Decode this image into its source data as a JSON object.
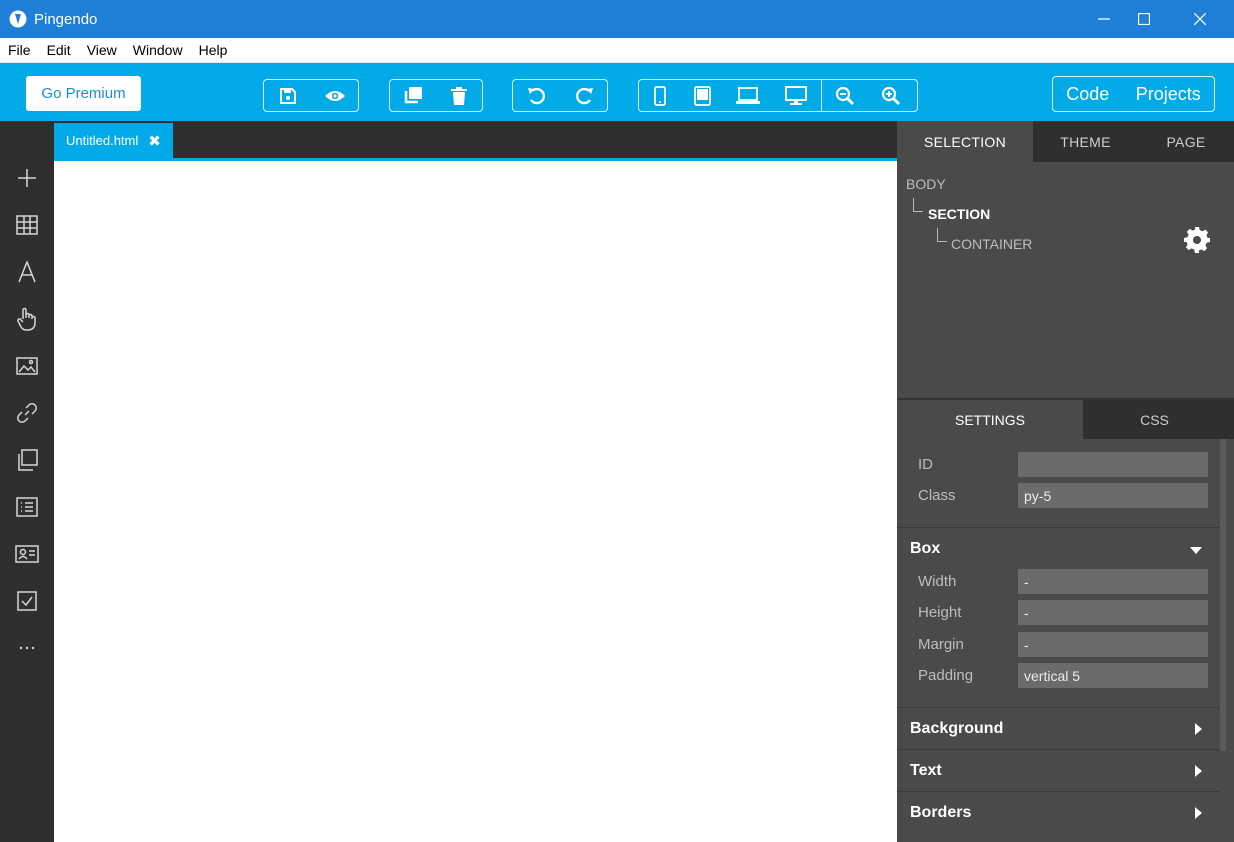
{
  "window": {
    "title": "Pingendo",
    "controls": [
      "minimize-icon",
      "maximize-icon",
      "close-icon"
    ]
  },
  "menu": [
    "File",
    "Edit",
    "View",
    "Window",
    "Help"
  ],
  "toolbar": {
    "premium_label": "Go Premium",
    "code_label": "Code",
    "projects_label": "Projects",
    "icons": [
      "save-icon",
      "preview-icon",
      "duplicate-icon",
      "delete-icon",
      "undo-icon",
      "redo-icon",
      "phone-icon",
      "tablet-icon",
      "laptop-icon",
      "desktop-icon",
      "zoom-out-icon",
      "zoom-in-icon"
    ]
  },
  "sidebar": {
    "icons": [
      "add-icon",
      "grid-icon",
      "text-icon",
      "hand-pointer-icon",
      "image-icon",
      "link-icon",
      "copy-icon",
      "list-icon",
      "card-icon",
      "checkbox-icon",
      "more-icon"
    ]
  },
  "editor": {
    "tab_label": "Untitled.html",
    "tab_close": "✖"
  },
  "panel": {
    "tabs": [
      "SELECTION",
      "THEME",
      "PAGE"
    ],
    "tree": {
      "body": "BODY",
      "section": "SECTION",
      "container": "CONTAINER"
    },
    "settings_tabs": [
      "SETTINGS",
      "CSS"
    ],
    "id_label": "ID",
    "id_value": "",
    "class_label": "Class",
    "class_value": "py-5",
    "box": {
      "title": "Box",
      "width_label": "Width",
      "width_value": "-",
      "height_label": "Height",
      "height_value": "-",
      "margin_label": "Margin",
      "margin_value": "-",
      "padding_label": "Padding",
      "padding_value": "vertical 5"
    },
    "sections": [
      "Background",
      "Text",
      "Borders"
    ]
  },
  "colors": {
    "titlebar": "#1e7fd6",
    "toolbar": "#03aae8",
    "dark": "#2f2f2f",
    "panel": "#4a4a4a"
  }
}
